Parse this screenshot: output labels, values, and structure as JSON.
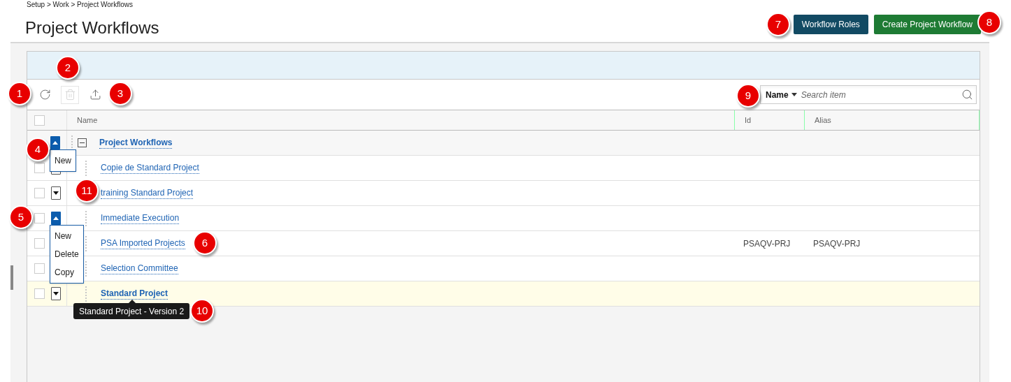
{
  "breadcrumb": "Setup > Work > Project Workflows",
  "title": "Project Workflows",
  "header_buttons": [
    {
      "label": "Workflow Roles",
      "kind": "secondary"
    },
    {
      "label": "Create Project Workflow",
      "kind": "primary"
    }
  ],
  "toolbar": {
    "buttons": [
      {
        "kind": "refresh",
        "disabled": false
      },
      {
        "kind": "delete",
        "disabled": true
      },
      {
        "kind": "export",
        "disabled": false
      }
    ],
    "search": {
      "filter": "Name",
      "placeholder": "Search item"
    }
  },
  "table": {
    "columns": [
      "Name",
      "Id",
      "Alias"
    ],
    "select_all_checked": false,
    "rows": [
      {
        "kind": "group",
        "name": "Project Workflows",
        "expanded": true,
        "menu_open": true,
        "menu": [
          "New"
        ],
        "highlighted": false,
        "children": [
          {
            "kind": "item",
            "name": "Copie de Standard Project",
            "checked": false,
            "menu_open": false,
            "highlighted": false
          },
          {
            "kind": "item",
            "name": "training Standard Project",
            "checked": false,
            "menu_open": false,
            "highlighted": false
          },
          {
            "kind": "item",
            "name": "Immediate Execution",
            "checked": false,
            "menu_open": true,
            "menu": [
              "New",
              "Delete",
              "Copy"
            ],
            "highlighted": false
          },
          {
            "kind": "item",
            "name": "PSA Imported Projects",
            "id": "PSAQV-PRJ",
            "alias": "PSAQV-PRJ",
            "checked": false,
            "menu_open": false,
            "highlighted": false
          },
          {
            "kind": "item",
            "name": "Selection Committee",
            "checked": false,
            "menu_open": false,
            "highlighted": false
          },
          {
            "kind": "item",
            "name": "Standard Project",
            "bold": true,
            "checked": false,
            "menu_open": false,
            "highlighted": true,
            "tooltip": "Standard Project - Version 2"
          }
        ]
      }
    ]
  },
  "callouts": [
    "1",
    "2",
    "3",
    "4",
    "5",
    "6",
    "7",
    "8",
    "9",
    "10",
    "11"
  ]
}
